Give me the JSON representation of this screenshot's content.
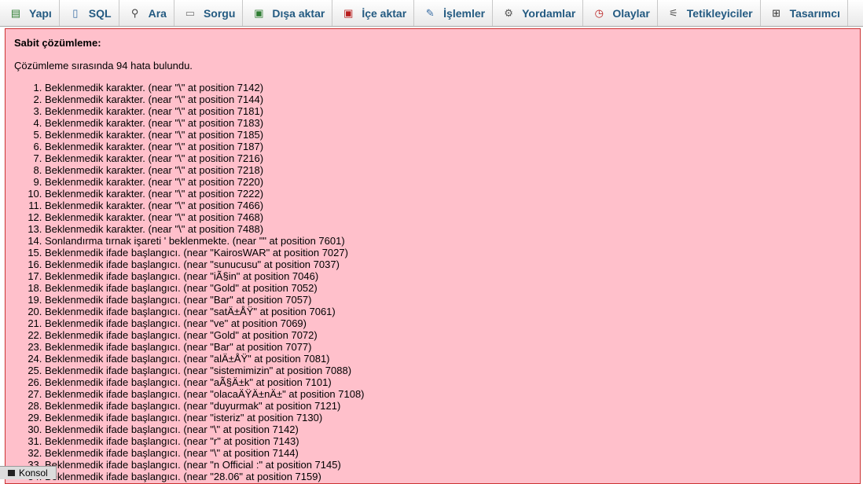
{
  "tabs": [
    {
      "label": "Yapı",
      "icon": "structure-icon",
      "glyph": "▤",
      "color": "#2e7d32"
    },
    {
      "label": "SQL",
      "icon": "sql-icon",
      "glyph": "▯",
      "color": "#3a6ea5"
    },
    {
      "label": "Ara",
      "icon": "search-icon",
      "glyph": "⚲",
      "color": "#444444"
    },
    {
      "label": "Sorgu",
      "icon": "query-icon",
      "glyph": "▭",
      "color": "#777777"
    },
    {
      "label": "Dışa aktar",
      "icon": "export-icon",
      "glyph": "▣",
      "color": "#2e7d32"
    },
    {
      "label": "İçe aktar",
      "icon": "import-icon",
      "glyph": "▣",
      "color": "#b71c1c"
    },
    {
      "label": "İşlemler",
      "icon": "wrench-icon",
      "glyph": "✎",
      "color": "#3a6ea5"
    },
    {
      "label": "Yordamlar",
      "icon": "routines-icon",
      "glyph": "⚙",
      "color": "#555555"
    },
    {
      "label": "Olaylar",
      "icon": "clock-icon",
      "glyph": "◷",
      "color": "#b71c1c"
    },
    {
      "label": "Tetikleyiciler",
      "icon": "triggers-icon",
      "glyph": "⚟",
      "color": "#555555"
    },
    {
      "label": "Tasarımcı",
      "icon": "designer-icon",
      "glyph": "⊞",
      "color": "#333333"
    }
  ],
  "error": {
    "title": "Sabit çözümleme:",
    "summary": "Çözümleme sırasında 94 hata bulundu.",
    "items": [
      "Beklenmedik karakter. (near \"\\\" at position 7142)",
      "Beklenmedik karakter. (near \"\\\" at position 7144)",
      "Beklenmedik karakter. (near \"\\\" at position 7181)",
      "Beklenmedik karakter. (near \"\\\" at position 7183)",
      "Beklenmedik karakter. (near \"\\\" at position 7185)",
      "Beklenmedik karakter. (near \"\\\" at position 7187)",
      "Beklenmedik karakter. (near \"\\\" at position 7216)",
      "Beklenmedik karakter. (near \"\\\" at position 7218)",
      "Beklenmedik karakter. (near \"\\\" at position 7220)",
      "Beklenmedik karakter. (near \"\\\" at position 7222)",
      "Beklenmedik karakter. (near \"\\\" at position 7466)",
      "Beklenmedik karakter. (near \"\\\" at position 7468)",
      "Beklenmedik karakter. (near \"\\\" at position 7488)",
      "Sonlandırma tırnak işareti ' beklenmekte. (near \"\" at position 7601)",
      "Beklenmedik ifade başlangıcı. (near \"KairosWAR\" at position 7027)",
      "Beklenmedik ifade başlangıcı. (near \"sunucusu\" at position 7037)",
      "Beklenmedik ifade başlangıcı. (near \"iÃ§in\" at position 7046)",
      "Beklenmedik ifade başlangıcı. (near \"Gold\" at position 7052)",
      "Beklenmedik ifade başlangıcı. (near \"Bar\" at position 7057)",
      "Beklenmedik ifade başlangıcı. (near \"satÄ±ÅŸ\" at position 7061)",
      "Beklenmedik ifade başlangıcı. (near \"ve\" at position 7069)",
      "Beklenmedik ifade başlangıcı. (near \"Gold\" at position 7072)",
      "Beklenmedik ifade başlangıcı. (near \"Bar\" at position 7077)",
      "Beklenmedik ifade başlangıcı. (near \"alÄ±ÅŸ\" at position 7081)",
      "Beklenmedik ifade başlangıcı. (near \"sistemimizin\" at position 7088)",
      "Beklenmedik ifade başlangıcı. (near \"aÃ§Ä±k\" at position 7101)",
      "Beklenmedik ifade başlangıcı. (near \"olacaÄŸÄ±nÄ±\" at position 7108)",
      "Beklenmedik ifade başlangıcı. (near \"duyurmak\" at position 7121)",
      "Beklenmedik ifade başlangıcı. (near \"isteriz\" at position 7130)",
      "Beklenmedik ifade başlangıcı. (near \"\\\" at position 7142)",
      "Beklenmedik ifade başlangıcı. (near \"r\" at position 7143)",
      "Beklenmedik ifade başlangıcı. (near \"\\\" at position 7144)",
      "Beklenmedik ifade başlangıcı. (near \"n Official :\" at position 7145)",
      "Beklenmedik ifade başlangıcı. (near \"28.06\" at position 7159)"
    ]
  },
  "console": {
    "label": "Konsol"
  }
}
